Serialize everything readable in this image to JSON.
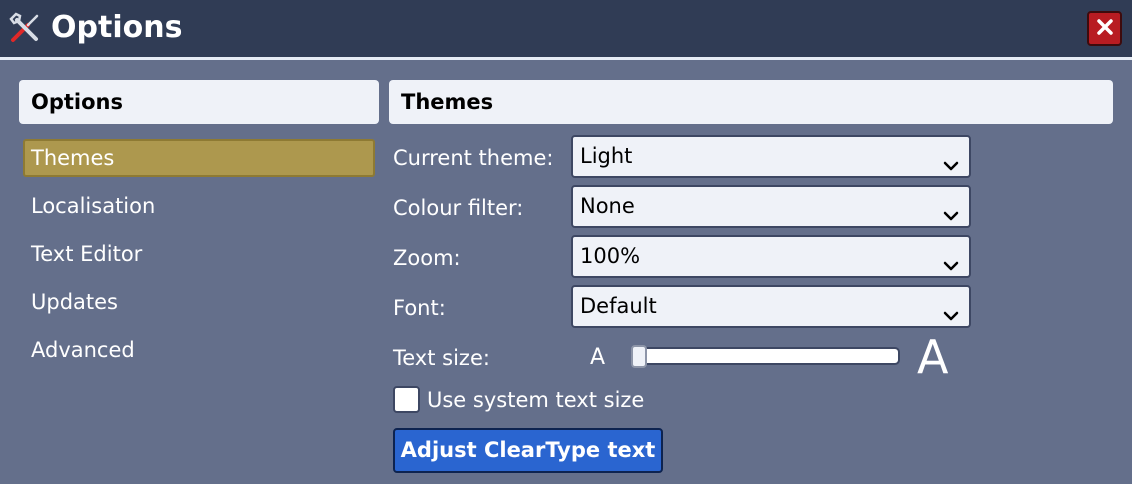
{
  "window": {
    "title": "Options",
    "app_icon": "tools-icon",
    "close_icon": "close-icon"
  },
  "sidebar": {
    "header": "Options",
    "items": [
      {
        "label": "Themes",
        "selected": true
      },
      {
        "label": "Localisation",
        "selected": false
      },
      {
        "label": "Text Editor",
        "selected": false
      },
      {
        "label": "Updates",
        "selected": false
      },
      {
        "label": "Advanced",
        "selected": false
      }
    ]
  },
  "main": {
    "header": "Themes",
    "fields": {
      "current_theme": {
        "label": "Current theme:",
        "value": "Light"
      },
      "colour_filter": {
        "label": "Colour filter:",
        "value": "None"
      },
      "zoom": {
        "label": "Zoom:",
        "value": "100%"
      },
      "font": {
        "label": "Font:",
        "value": "Default"
      }
    },
    "text_size": {
      "label": "Text size:",
      "small_glyph": "A",
      "large_glyph": "A",
      "level": 0
    },
    "use_system_text_size": {
      "label": "Use system text size",
      "checked": false
    },
    "cleartype_button": "Adjust ClearType text"
  },
  "colors": {
    "background": "#646f8b",
    "titlebar": "#303c55",
    "selected_item": "#ad984e",
    "close_button": "#b81c22",
    "primary_button": "#2a65d0"
  }
}
